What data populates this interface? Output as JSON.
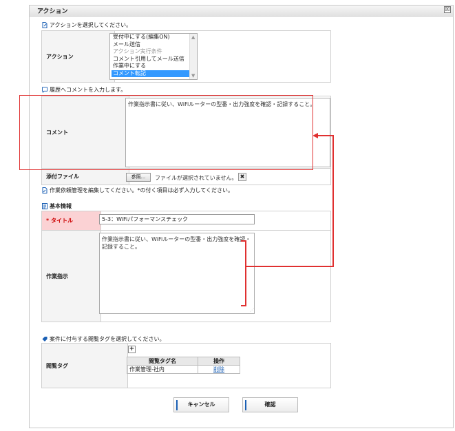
{
  "dialog": {
    "title": "アクション",
    "close": "☒"
  },
  "action_section": {
    "instruction": "アクションを選択してください。",
    "label": "アクション",
    "options": [
      {
        "text": "受付中にする(編集ON)",
        "state": "normal"
      },
      {
        "text": "メール送信",
        "state": "normal"
      },
      {
        "text": "アクション実行条件",
        "state": "disabled"
      },
      {
        "text": "コメント引用してメール送信",
        "state": "normal"
      },
      {
        "text": "作業中にする",
        "state": "normal"
      },
      {
        "text": "コメント転記",
        "state": "selected"
      }
    ]
  },
  "comment_section": {
    "instruction": "履歴へコメントを入力します。",
    "label": "コメント",
    "value": "作業指示書に従い、WiFiルーターの型番・出力強度を確認・記録すること。",
    "attach_label": "添付ファイル",
    "browse_label": "参照...",
    "no_file_text": "ファイルが選択されていません。",
    "clear_label": "✖"
  },
  "work_section": {
    "instruction": "作業依頼管理を編集してください。*の付く項目は必ず入力してください。",
    "basic_info": "基本情報",
    "title_label": "タイトル",
    "required_mark": "*",
    "title_value": "5-3：WiFiパフォーマンスチェック",
    "instruction_label": "作業指示",
    "instruction_value": "作業指示書に従い、WiFiルーターの型番・出力強度を確認・記録すること。"
  },
  "tag_section": {
    "instruction": "案件に付与する閲覧タグを選択してください。",
    "label": "閲覧タグ",
    "add": "+",
    "headers": [
      "閲覧タグ名",
      "操作"
    ],
    "rows": [
      {
        "name": "作業管理-社内",
        "action": "削除"
      }
    ]
  },
  "buttons": {
    "cancel": "キャンセル",
    "confirm": "確認"
  },
  "colors": {
    "accent": "#1a5fb4",
    "highlight": "#e03030",
    "selected": "#3399ff",
    "required_bg": "#fbd2d4"
  }
}
